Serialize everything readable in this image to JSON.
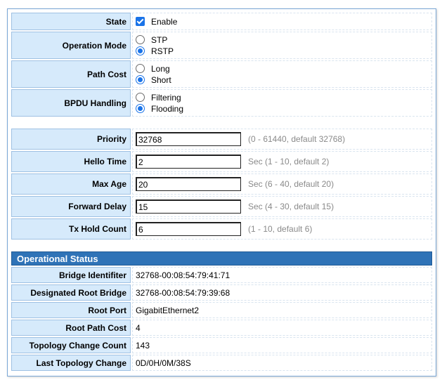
{
  "stp": {
    "state": {
      "label": "State",
      "checkbox_label": "Enable",
      "checked": true
    },
    "operation_mode": {
      "label": "Operation Mode",
      "options": [
        "STP",
        "RSTP"
      ],
      "selected": "RSTP"
    },
    "path_cost": {
      "label": "Path Cost",
      "options": [
        "Long",
        "Short"
      ],
      "selected": "Short"
    },
    "bpdu_handling": {
      "label": "BPDU Handling",
      "options": [
        "Filtering",
        "Flooding"
      ],
      "selected": "Flooding"
    }
  },
  "timers": {
    "priority": {
      "label": "Priority",
      "value": "32768",
      "hint": "(0 - 61440, default 32768)"
    },
    "hello_time": {
      "label": "Hello Time",
      "value": "2",
      "hint": "Sec (1 - 10, default 2)"
    },
    "max_age": {
      "label": "Max Age",
      "value": "20",
      "hint": "Sec (6 - 40, default 20)"
    },
    "forward_delay": {
      "label": "Forward Delay",
      "value": "15",
      "hint": "Sec (4 - 30, default 15)"
    },
    "tx_hold_count": {
      "label": "Tx Hold Count",
      "value": "6",
      "hint": "(1 - 10, default 6)"
    }
  },
  "status": {
    "title": "Operational Status",
    "rows": [
      {
        "label": "Bridge Identifiter",
        "value": "32768-00:08:54:79:41:71"
      },
      {
        "label": "Designated Root Bridge",
        "value": "32768-00:08:54:79:39:68"
      },
      {
        "label": "Root Port",
        "value": "GigabitEthernet2"
      },
      {
        "label": "Root Path Cost",
        "value": "4"
      },
      {
        "label": "Topology Change Count",
        "value": "143"
      },
      {
        "label": "Last Topology Change",
        "value": "0D/0H/0M/38S"
      }
    ]
  },
  "colors": {
    "label_bg": "#d6eafb",
    "header_bg": "#2f73b7",
    "accent": "#1a73e8"
  }
}
